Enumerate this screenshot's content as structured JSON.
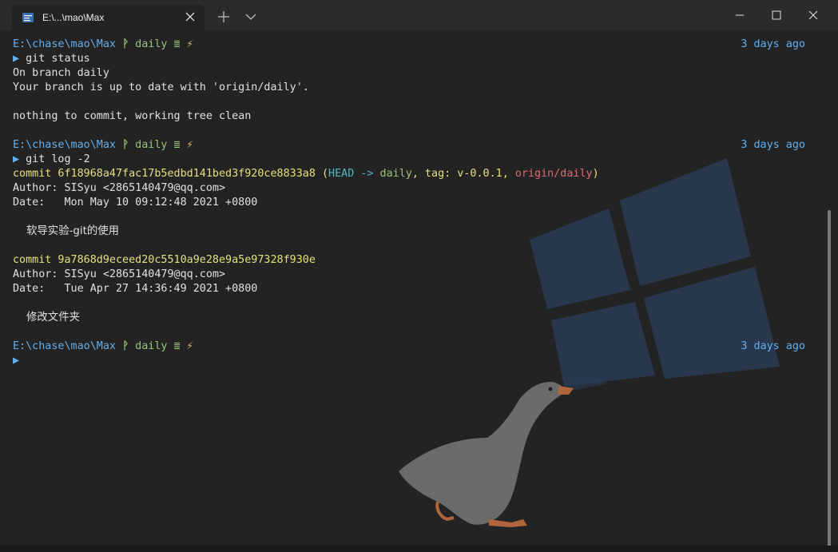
{
  "tab": {
    "title": "E:\\...\\mao\\Max",
    "icon": "terminal-icon"
  },
  "window_controls": [
    "minimize-icon",
    "maximize-icon",
    "close-icon"
  ],
  "colors": {
    "path": "#61afef",
    "branch": "#98c379",
    "bolt": "#e5c07b",
    "hash": "#e5e07b",
    "head": "#56b6c2",
    "origin": "#e06c75"
  },
  "prompt": {
    "path": "E:\\chase\\mao\\Max",
    "branch_symbol": "ᚹ",
    "branch": "daily",
    "stash_symbol": "≣",
    "bolt": "⚡",
    "arrow": "▶",
    "time": "3 days ago"
  },
  "block1": {
    "command": "git status",
    "out1": "On branch daily",
    "out2": "Your branch is up to date with 'origin/daily'.",
    "out3": "nothing to commit, working tree clean"
  },
  "block2": {
    "command": "git log -2",
    "c1_prefix": "commit 6f18968a47fac17b5edbd141bed3f920ce8833a8 ",
    "c1_paren_open": "(",
    "c1_head": "HEAD -> ",
    "c1_branch": "daily",
    "c1_comma1": ", ",
    "c1_tag": "tag: v-0.0.1",
    "c1_comma2": ", ",
    "c1_origin": "origin/daily",
    "c1_paren_close": ")",
    "c1_author": "Author: SISyu <2865140479@qq.com>",
    "c1_date": "Date:   Mon May 10 09:12:48 2021 +0800",
    "c1_msg": "    软导实验-git的使用",
    "c2_commit": "commit 9a7868d9eceed20c5510a9e28e9a5e97328f930e",
    "c2_author": "Author: SISyu <2865140479@qq.com>",
    "c2_date": "Date:   Tue Apr 27 14:36:49 2021 +0800",
    "c2_msg": "    修改文件夹"
  }
}
